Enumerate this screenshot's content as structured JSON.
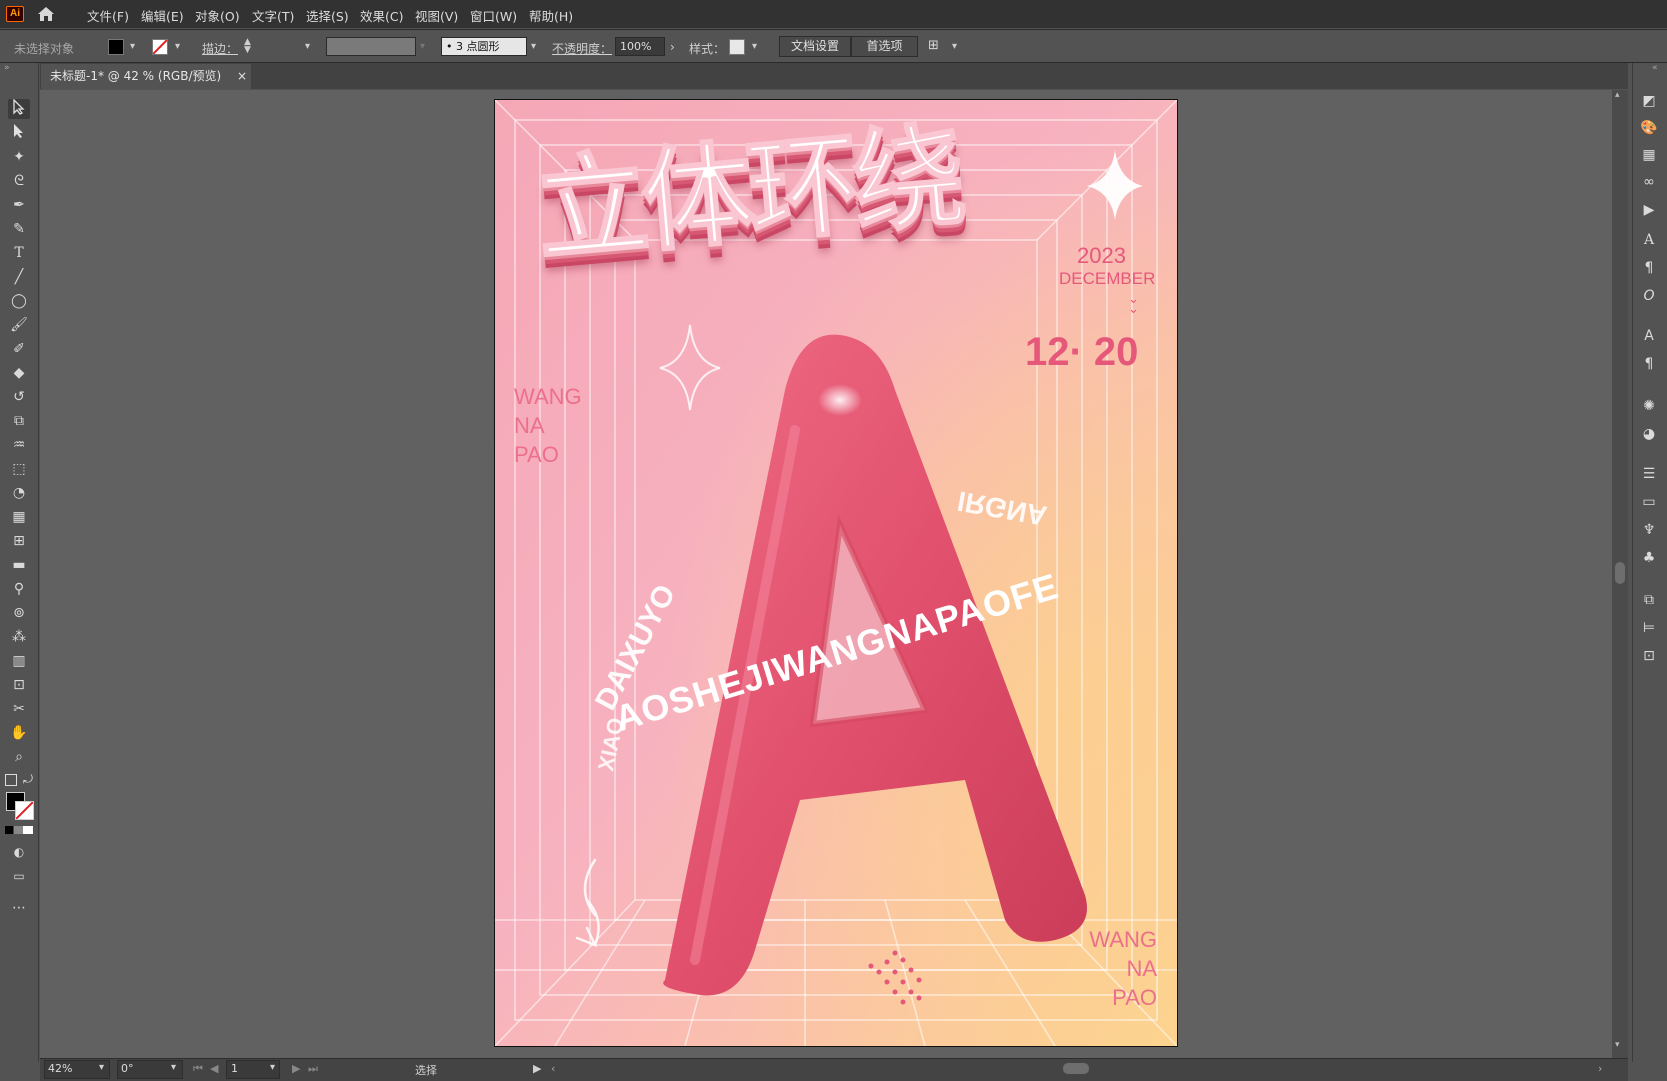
{
  "menubar": {
    "logo": "Ai",
    "items": [
      "文件(F)",
      "编辑(E)",
      "对象(O)",
      "文字(T)",
      "选择(S)",
      "效果(C)",
      "视图(V)",
      "窗口(W)",
      "帮助(H)"
    ]
  },
  "controlbar": {
    "selection_status": "未选择对象",
    "stroke_label": "描边：",
    "brush_value": "3 点圆形",
    "opacity_label": "不透明度：",
    "opacity_value": "100%",
    "style_label": "样式：",
    "doc_setup_button": "文档设置",
    "preferences_button": "首选项"
  },
  "document_tab": {
    "title": "未标题-1* @ 42 % (RGB/预览)",
    "close": "×"
  },
  "poster": {
    "headline": "立体环绕",
    "year": "2023",
    "month": "DECEMBER",
    "date": "12· 20",
    "letter": "A",
    "left_block": [
      "WANG",
      "NA",
      "PAO"
    ],
    "bottom_block": [
      "WANG",
      "NA",
      "PAO"
    ],
    "ring_text_front": "AOSHEJIWANGNAPAOFE",
    "ring_text_left": "DAIXUYO",
    "ring_text_left2": "XIAO",
    "ring_text_back": "IRGNA"
  },
  "statusbar": {
    "zoom": "42%",
    "rotation": "0°",
    "artboard_number": "1",
    "tool_status": "选择"
  },
  "colors": {
    "app_bg": "#535353",
    "menu_bg": "#323232",
    "poster_pink": "#f6a6b7",
    "letter_red": "#e2536d",
    "accent_text": "#e5587a"
  }
}
